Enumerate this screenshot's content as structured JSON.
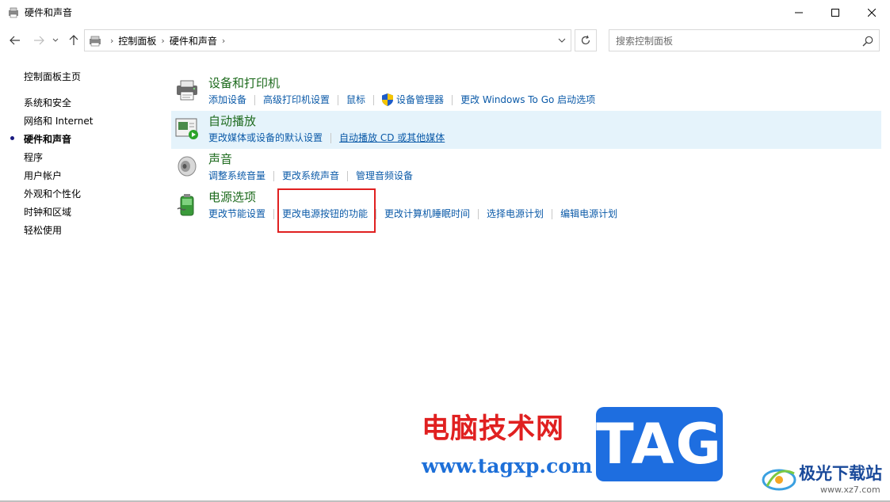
{
  "window": {
    "title": "硬件和声音",
    "minimize": "—",
    "maximize": "☐",
    "close": "✕"
  },
  "nav": {
    "back": "←",
    "forward": "→",
    "recent": "⌄",
    "up": "↑",
    "refresh": "↻",
    "dropdown": "⌄"
  },
  "breadcrumb": {
    "items": [
      "控制面板",
      "硬件和声音"
    ],
    "separator": "›"
  },
  "search": {
    "placeholder": "搜索控制面板"
  },
  "sidebar": {
    "home": "控制面板主页",
    "items": [
      {
        "label": "系统和安全",
        "active": false
      },
      {
        "label": "网络和 Internet",
        "active": false
      },
      {
        "label": "硬件和声音",
        "active": true
      },
      {
        "label": "程序",
        "active": false
      },
      {
        "label": "用户帐户",
        "active": false
      },
      {
        "label": "外观和个性化",
        "active": false
      },
      {
        "label": "时钟和区域",
        "active": false
      },
      {
        "label": "轻松使用",
        "active": false
      }
    ]
  },
  "categories": [
    {
      "title": "设备和打印机",
      "icon": "printer-icon",
      "links": [
        "添加设备",
        "高级打印机设置",
        "鼠标",
        "设备管理器",
        "更改 Windows To Go 启动选项"
      ]
    },
    {
      "title": "自动播放",
      "icon": "autoplay-icon",
      "links": [
        "更改媒体或设备的默认设置",
        "自动播放 CD 或其他媒体"
      ]
    },
    {
      "title": "声音",
      "icon": "speaker-icon",
      "links": [
        "调整系统音量",
        "更改系统声音",
        "管理音频设备"
      ]
    },
    {
      "title": "电源选项",
      "icon": "battery-icon",
      "links": [
        "更改节能设置",
        "更改电源按钮的功能",
        "更改计算机睡眠时间",
        "选择电源计划",
        "编辑电源计划"
      ]
    }
  ],
  "watermark": {
    "cn_text": "电脑技术网",
    "url": "www.tagxp.com",
    "tag": "TAG",
    "site_text": "极光下载站",
    "site_url": "www.xz7.com"
  },
  "colors": {
    "category_title": "#1e6b1e",
    "link": "#0b5aa8",
    "highlight": "#e5f3fb",
    "annotation": "#e02020"
  }
}
